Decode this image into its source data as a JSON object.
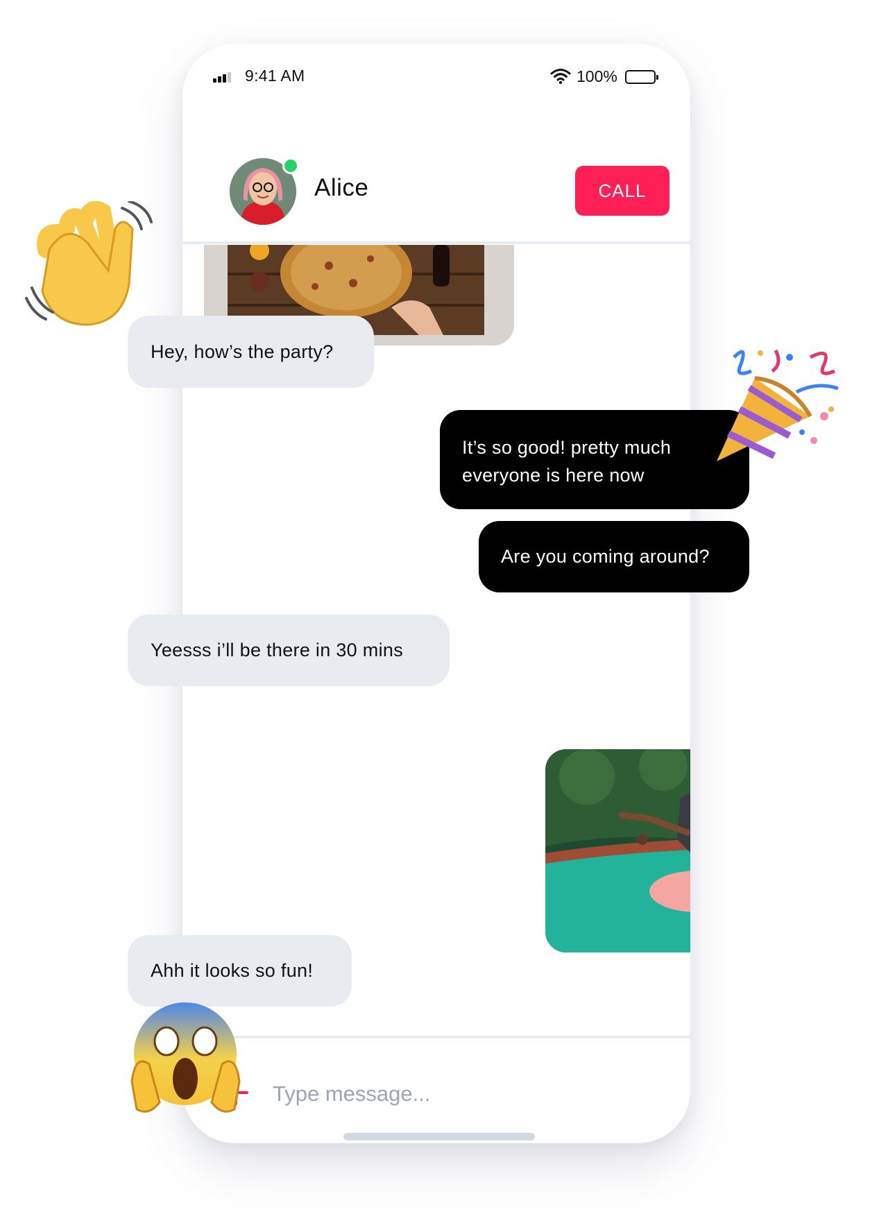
{
  "status_bar": {
    "time": "9:41 AM",
    "battery": "100%",
    "icons": [
      "signal-icon",
      "wifi-icon",
      "battery-icon"
    ]
  },
  "header": {
    "contact_name": "Alice",
    "call_label": "CALL",
    "online": true,
    "avatar_icon": "avatar"
  },
  "messages": [
    {
      "type": "image",
      "from": "outgoing",
      "subject": "pizza-photo"
    },
    {
      "type": "text",
      "from": "incoming",
      "text": "Hey, how’s the party?"
    },
    {
      "type": "text",
      "from": "outgoing",
      "text": "It’s so good! pretty much everyone is here now"
    },
    {
      "type": "text",
      "from": "outgoing",
      "text": "Are you coming around?"
    },
    {
      "type": "text",
      "from": "incoming",
      "text": "Yeesss i’ll be there in 30 mins"
    },
    {
      "type": "image",
      "from": "outgoing",
      "subject": "pool-party-photo"
    },
    {
      "type": "text",
      "from": "incoming",
      "text": "Ahh it looks so fun!"
    }
  ],
  "composer": {
    "placeholder": "Type message...",
    "value": "",
    "add_icon": "plus-icon"
  },
  "decorations": [
    "waving-hand-emoji",
    "party-popper-emoji",
    "screaming-face-emoji"
  ],
  "colors": {
    "accent": "#ff1f57",
    "online": "#26d36b",
    "incoming_bubble": "#e8ecf1",
    "outgoing_bubble": "#000000",
    "placeholder": "#9aa5b5"
  }
}
